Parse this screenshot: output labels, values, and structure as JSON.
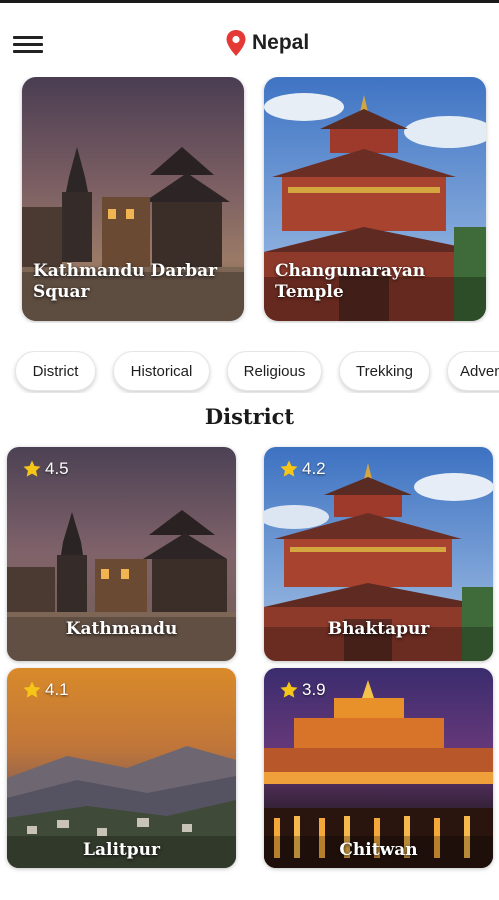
{
  "header": {
    "location": "Nepal",
    "menu_icon": "hamburger-menu-icon",
    "location_icon": "location-pin-icon",
    "pin_color": "#e53935"
  },
  "featured": [
    {
      "title": "Kathmandu Darbar Squar"
    },
    {
      "title": "Changunarayan Temple"
    }
  ],
  "categories": [
    "District",
    "Historical",
    "Religious",
    "Trekking",
    "Adventure"
  ],
  "section_title": "District",
  "districts": [
    {
      "name": "Kathmandu",
      "rating": "4.5"
    },
    {
      "name": "Bhaktapur",
      "rating": "4.2"
    },
    {
      "name": "Lalitpur",
      "rating": "4.1"
    },
    {
      "name": "Chitwan",
      "rating": "3.9"
    }
  ],
  "colors": {
    "star": "#f5c518",
    "text": "#1f1f1f"
  }
}
